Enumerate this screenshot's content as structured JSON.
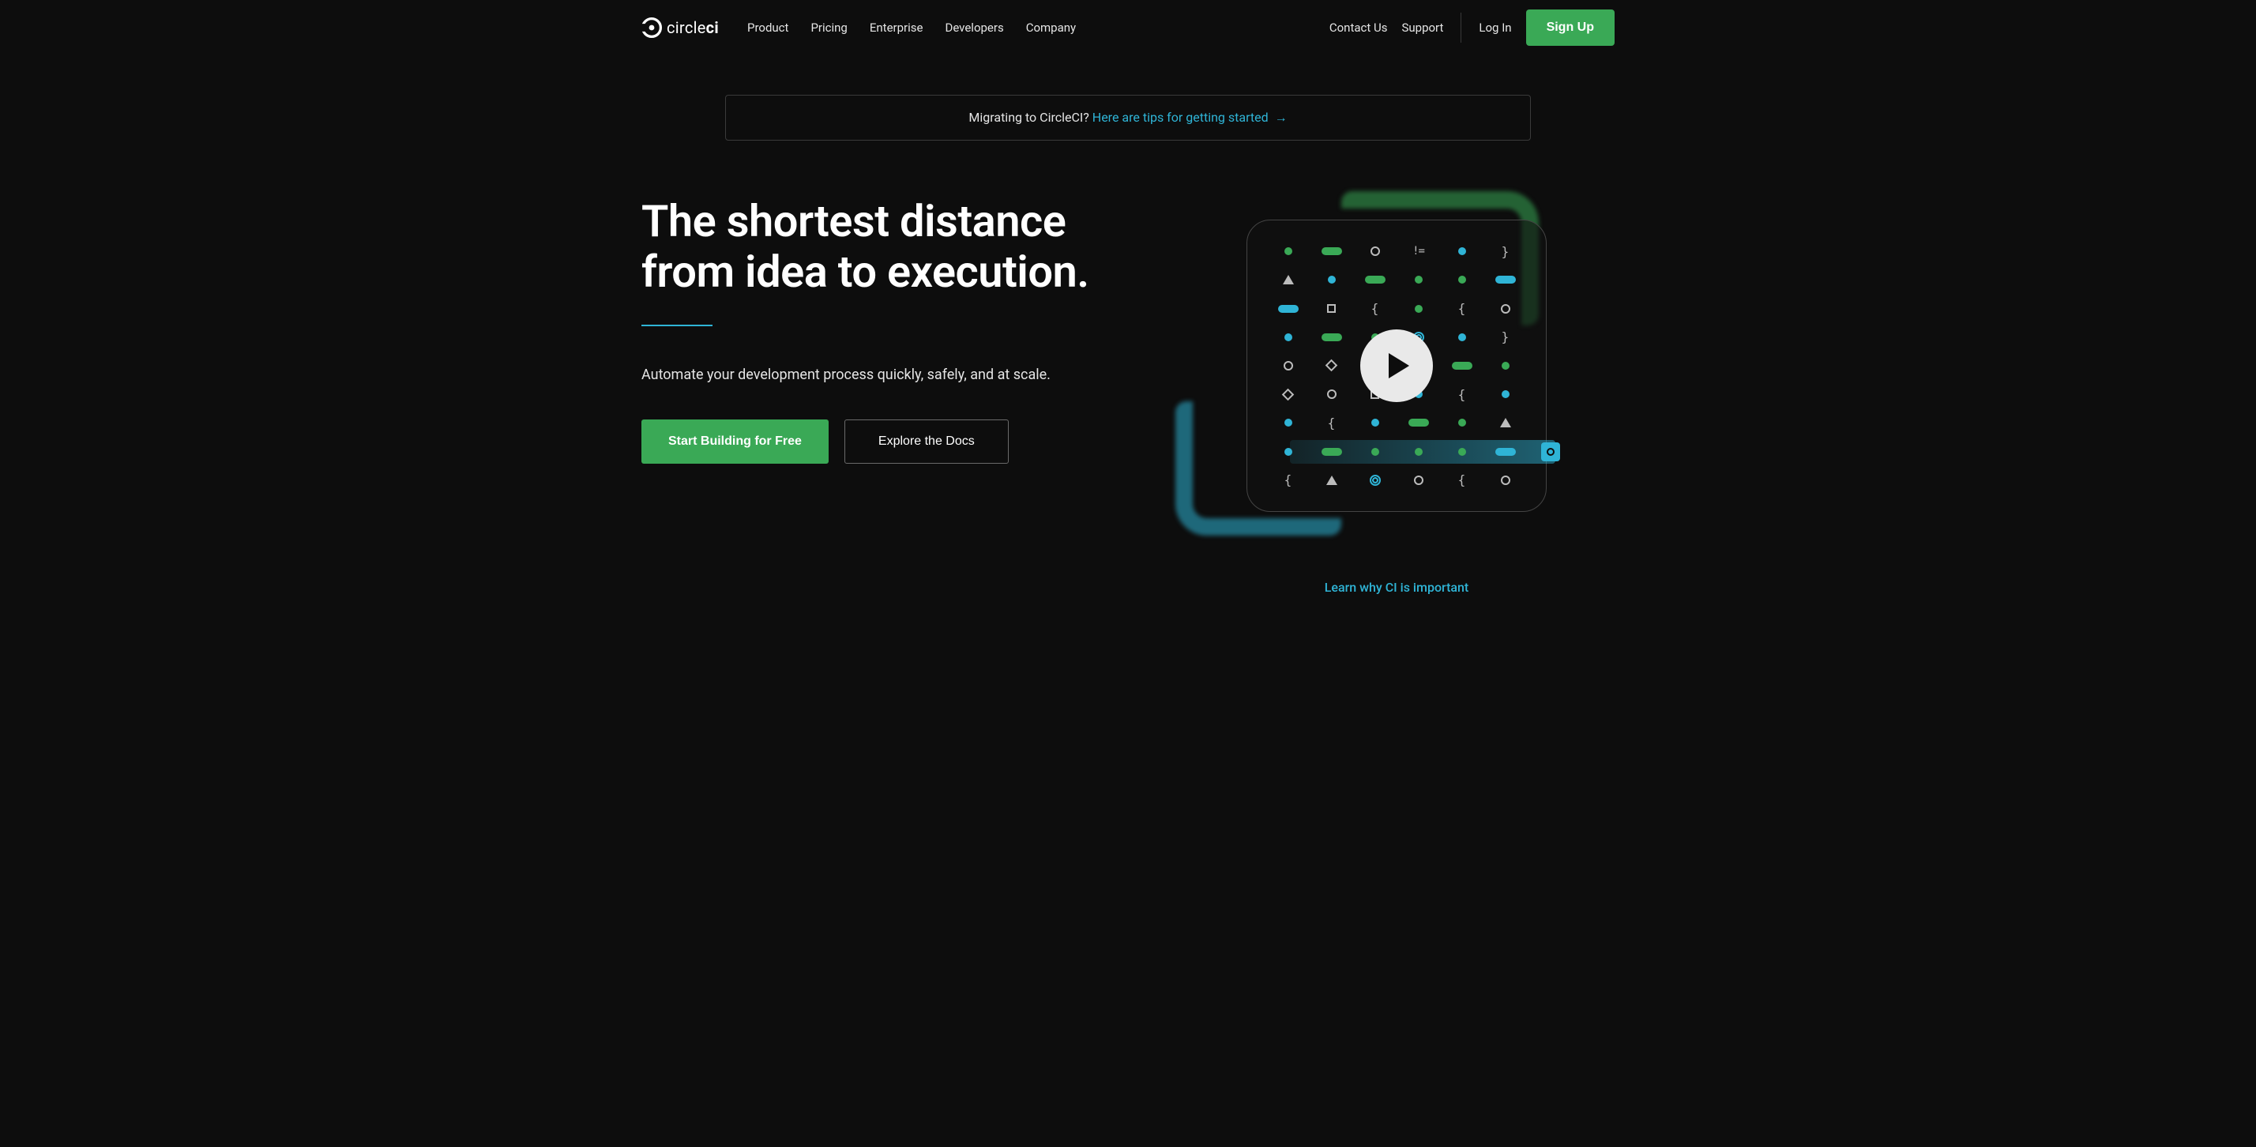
{
  "brand": {
    "name_light": "circle",
    "name_bold": "ci"
  },
  "nav": {
    "main": [
      "Product",
      "Pricing",
      "Enterprise",
      "Developers",
      "Company"
    ],
    "right": {
      "contact": "Contact Us",
      "support": "Support",
      "login": "Log In",
      "signup": "Sign Up"
    }
  },
  "banner": {
    "prefix": "Migrating to CircleCI? ",
    "link": "Here are tips for getting started",
    "arrow": "→"
  },
  "hero": {
    "title": "The shortest distance from idea to execution.",
    "subtitle": "Automate your development process quickly, safely, and at scale.",
    "cta_primary": "Start Building for Free",
    "cta_secondary": "Explore the Docs",
    "learn_link": "Learn why CI is important"
  }
}
